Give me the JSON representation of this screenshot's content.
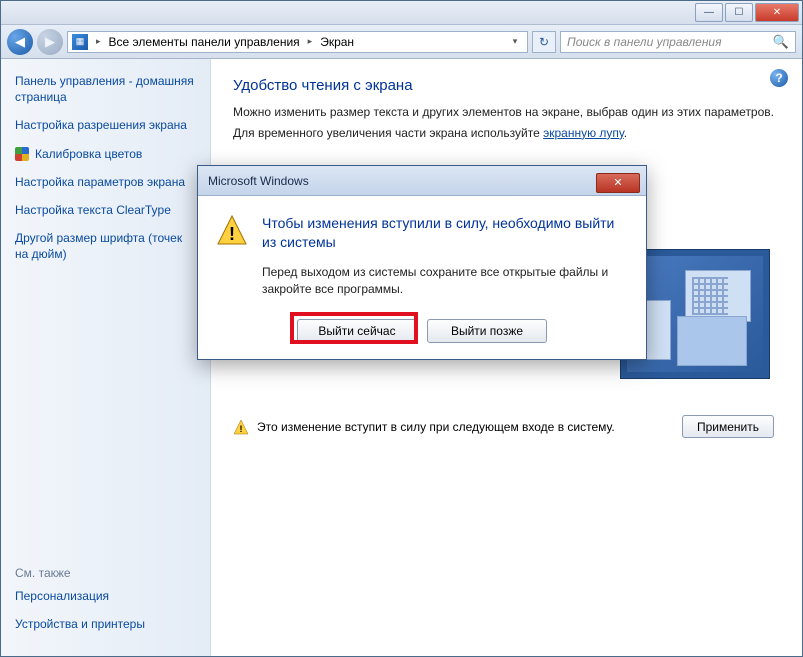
{
  "titlebar": {
    "min_label": "—",
    "max_label": "☐",
    "close_label": "✕"
  },
  "nav": {
    "back_glyph": "◀",
    "fwd_glyph": "▶",
    "addr_icon_glyph": "▦",
    "sep_glyph": "▸",
    "dropdown_glyph": "▾",
    "refresh_glyph": "↻",
    "search_glyph": "🔍"
  },
  "addressbar": {
    "segments": [
      "Все элементы панели управления",
      "Экран"
    ]
  },
  "search": {
    "placeholder": "Поиск в панели управления"
  },
  "sidebar": {
    "home": "Панель управления - домашняя страница",
    "links": [
      "Настройка разрешения экрана",
      "Калибровка цветов",
      "Настройка параметров экрана",
      "Настройка текста ClearType",
      "Другой размер шрифта (точек на дюйм)"
    ],
    "see_also_header": "См. также",
    "see_also": [
      "Персонализация",
      "Устройства и принтеры"
    ]
  },
  "main": {
    "heading": "Удобство чтения с экрана",
    "desc1": "Можно изменить размер текста и других элементов на экране, выбрав один из этих параметров.",
    "desc2_prefix": "Для временного увеличения части экрана используйте ",
    "desc2_link": "экранную лупу",
    "desc2_suffix": ".",
    "warning_text": "Это изменение вступит в силу при следующем входе в систему.",
    "apply_label": "Применить",
    "help_glyph": "?"
  },
  "dialog": {
    "title": "Microsoft Windows",
    "close_glyph": "✕",
    "heading": "Чтобы изменения вступили в силу, необходимо выйти из системы",
    "body": "Перед выходом из системы сохраните все открытые файлы и закройте все программы.",
    "btn_now": "Выйти сейчас",
    "btn_later": "Выйти позже"
  }
}
